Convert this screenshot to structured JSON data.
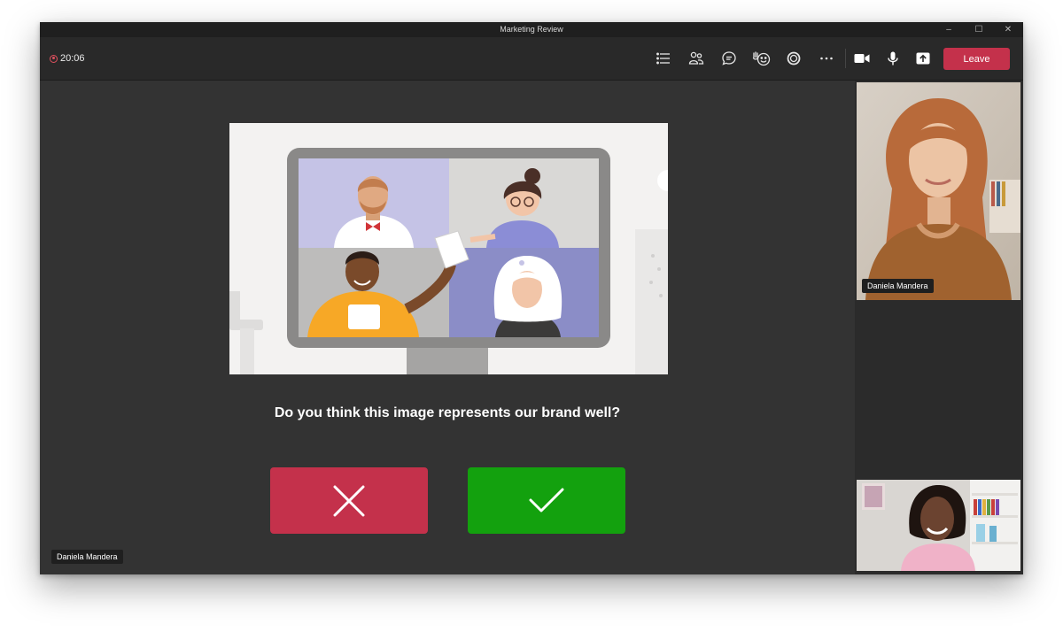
{
  "window": {
    "title": "Marketing Review",
    "controls": {
      "minimize": "–",
      "maximize": "☐",
      "close": "✕"
    }
  },
  "toolbar": {
    "timer": "20:06",
    "icons": [
      "list-icon",
      "people-icon",
      "chat-icon",
      "raise-hand-icon",
      "reactions-icon",
      "more-icon",
      "camera-icon",
      "microphone-icon",
      "share-icon"
    ],
    "leave_label": "Leave"
  },
  "stage": {
    "question": "Do you think this image represents our brand well?",
    "buttons": {
      "no": "close-icon",
      "yes": "check-icon"
    },
    "presenter_name": "Daniela Mandera"
  },
  "participants": [
    {
      "name": "Daniela Mandera"
    },
    {
      "name": ""
    }
  ],
  "colors": {
    "leave": "#c4314b",
    "vote_no": "#c4314b",
    "vote_yes": "#13a10e",
    "stage_bg": "#333333",
    "toolbar_bg": "#292929"
  }
}
